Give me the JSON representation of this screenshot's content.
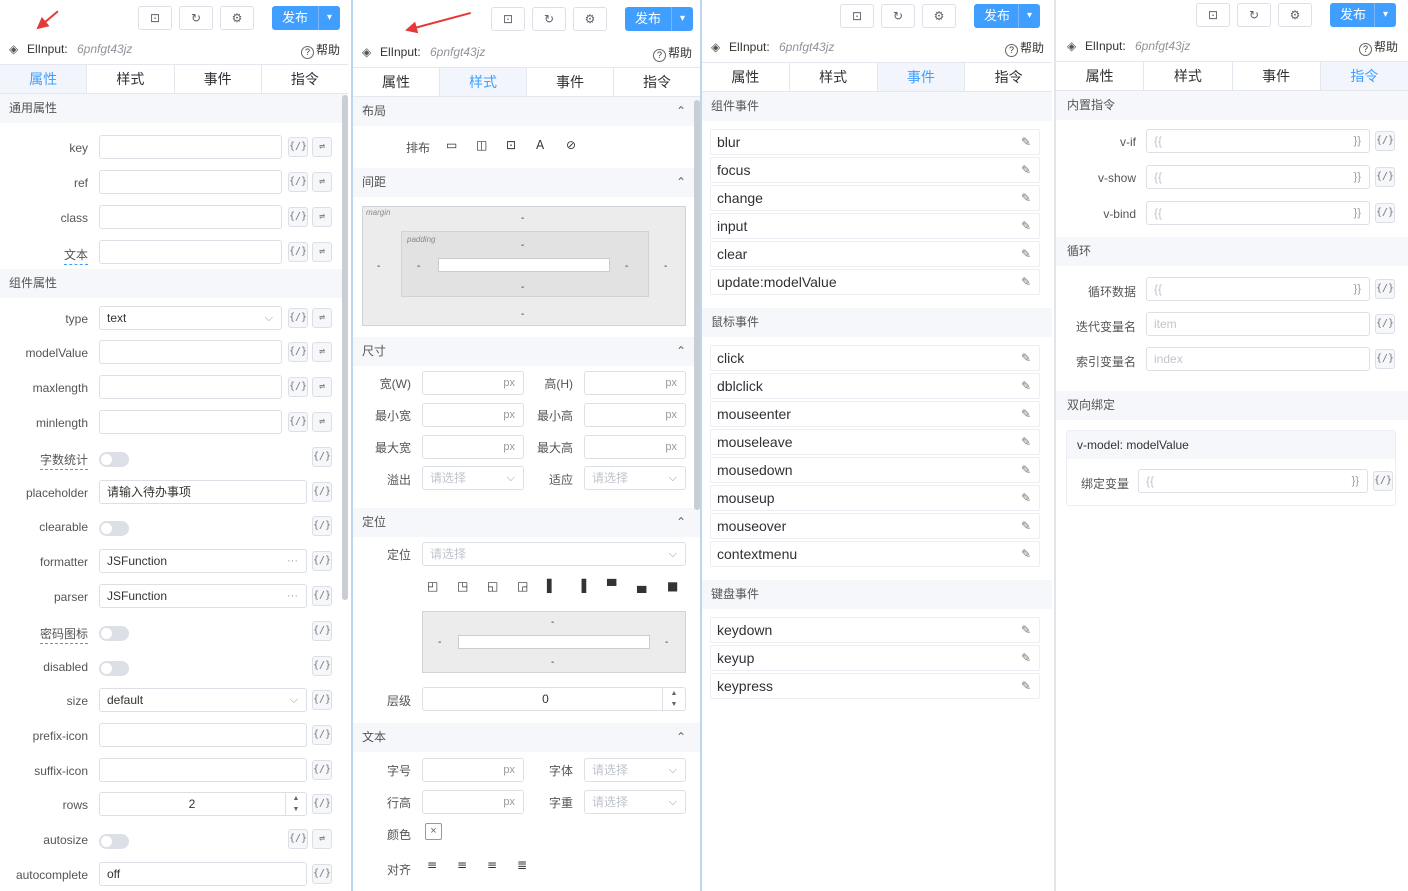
{
  "toolbar": {
    "publish": "发布",
    "dropdown": "▾",
    "icon_screenshot": "⊡",
    "icon_refresh": "↻",
    "icon_settings": "⚙"
  },
  "header": {
    "component": "ElInput:",
    "id": "6pnfgt43jz",
    "help": "帮助",
    "help_icon": "?",
    "layers_icon": "◈"
  },
  "tabs": [
    "属性",
    "样式",
    "事件",
    "指令"
  ],
  "props": {
    "general_title": "通用属性",
    "general": [
      {
        "label": "key",
        "value": ""
      },
      {
        "label": "ref",
        "value": ""
      },
      {
        "label": "class",
        "value": ""
      },
      {
        "label": "文本",
        "value": ""
      }
    ],
    "component_title": "组件属性",
    "type_label": "type",
    "type_value": "text",
    "modelValue": "modelValue",
    "maxlength": "maxlength",
    "minlength": "minlength",
    "showWordLimit": "字数统计",
    "placeholder_label": "placeholder",
    "placeholder_value": "请输入待办事项",
    "clearable": "clearable",
    "formatter_label": "formatter",
    "formatter_value": "JSFunction",
    "parser_label": "parser",
    "parser_value": "JSFunction",
    "showPassword": "密码图标",
    "disabled": "disabled",
    "size_label": "size",
    "size_value": "default",
    "prefix": "prefix-icon",
    "suffix": "suffix-icon",
    "rows_label": "rows",
    "rows_value": "2",
    "autosize": "autosize",
    "autocomplete_label": "autocomplete",
    "autocomplete_value": "off",
    "bind_icon": "{/}",
    "swap_icon": "⇌",
    "more_icon": "···"
  },
  "style": {
    "layout": "布局",
    "arrange": "排布",
    "spacing": "间距",
    "margin": "margin",
    "padding": "padding",
    "size": "尺寸",
    "width": "宽(W)",
    "height": "高(H)",
    "min_w": "最小宽",
    "min_h": "最小高",
    "max_w": "最大宽",
    "max_h": "最大高",
    "unit": "px",
    "overflow": "溢出",
    "fit": "适应",
    "select_ph": "请选择",
    "position": "定位",
    "position_label": "定位",
    "zindex": "层级",
    "zindex_value": "0",
    "text": "文本",
    "font_size": "字号",
    "font": "字体",
    "line_h": "行高",
    "weight": "字重",
    "color": "颜色",
    "align": "对齐",
    "dash": "-"
  },
  "events": {
    "component_title": "组件事件",
    "component": [
      "blur",
      "focus",
      "change",
      "input",
      "clear",
      "update:modelValue"
    ],
    "mouse_title": "鼠标事件",
    "mouse": [
      "click",
      "dblclick",
      "mouseenter",
      "mouseleave",
      "mousedown",
      "mouseup",
      "mouseover",
      "contextmenu"
    ],
    "keyboard_title": "键盘事件",
    "keyboard": [
      "keydown",
      "keyup",
      "keypress"
    ],
    "edit_icon": "✎"
  },
  "directives": {
    "builtin": "内置指令",
    "vif": "v-if",
    "vshow": "v-show",
    "vbind": "v-bind",
    "loop": "循环",
    "loop_data": "循环数据",
    "iter_var": "迭代变量名",
    "iter_ph": "item",
    "index_var": "索引变量名",
    "index_ph": "index",
    "twoway": "双向绑定",
    "vmodel": "v-model: modelValue",
    "bind_var": "绑定变量",
    "open": "{{",
    "close": "}}"
  }
}
